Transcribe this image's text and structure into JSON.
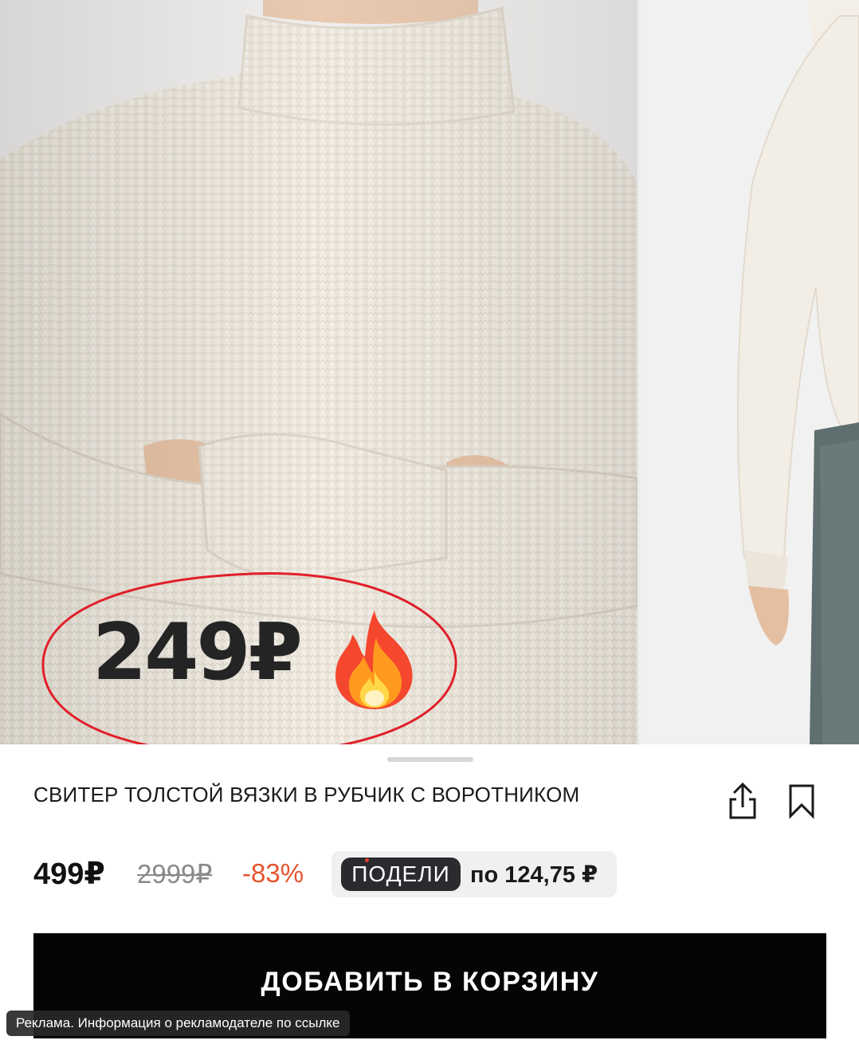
{
  "gallery": {
    "overlay_price": "249₽",
    "overlay_icon": "fire-icon"
  },
  "product": {
    "title": "СВИТЕР ТОЛСТОЙ ВЯЗКИ В РУБЧИК С ВОРОТНИКОМ",
    "price": "499₽",
    "old_price": "2999₽",
    "discount": "-83%"
  },
  "split": {
    "logo": "ПОДЕЛИ",
    "text": "по 124,75 ₽"
  },
  "actions": {
    "share_icon": "share-icon",
    "bookmark_icon": "bookmark-icon",
    "add_to_cart": "ДОБАВИТЬ В КОРЗИНУ"
  },
  "ad": {
    "notice": "Реклама. Информация о рекламодателе по ссылке"
  },
  "colors": {
    "discount": "#e5532e",
    "button": "#050505",
    "highlight": "#e0202a"
  }
}
